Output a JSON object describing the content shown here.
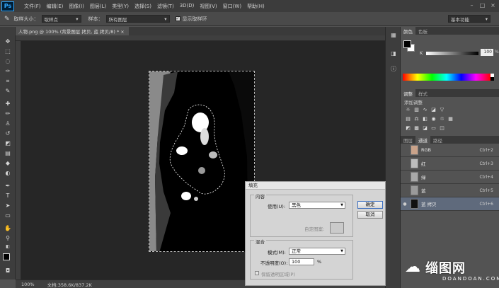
{
  "app": {
    "logo": "Ps",
    "menus": [
      "文件(F)",
      "编辑(E)",
      "图像(I)",
      "图层(L)",
      "类型(Y)",
      "选择(S)",
      "滤镜(T)",
      "3D(D)",
      "视图(V)",
      "窗口(W)",
      "帮助(H)"
    ]
  },
  "options_bar": {
    "sample_size_label": "取样大小：",
    "sample_size_value": "取样点",
    "sample_label": "样本：",
    "sample_value": "所有图层",
    "show_ring_label": "显示取样环",
    "workspace_value": "基本功能"
  },
  "document": {
    "tab_title": "人物.png @ 100% (背景图层 拷贝, 蓝 拷贝/8) * ×"
  },
  "status": {
    "zoom": "100%",
    "doc_info": "文档:358.6K/837.2K"
  },
  "colors": {
    "foreground": "#000000",
    "background": "#ffffff"
  },
  "panels": {
    "color_tabs": [
      "颜色",
      "色板"
    ],
    "color_k_label": "K",
    "color_k_value": "100",
    "color_k_unit": "%",
    "adjust_tabs": [
      "调整",
      "样式"
    ],
    "adjust_title": "添加调整",
    "layer_tabs": [
      "图层",
      "通道",
      "路径"
    ],
    "channels": [
      {
        "name": "RGB",
        "shortcut": "Ctrl+2"
      },
      {
        "name": "红",
        "shortcut": "Ctrl+3"
      },
      {
        "name": "绿",
        "shortcut": "Ctrl+4"
      },
      {
        "name": "蓝",
        "shortcut": "Ctrl+5"
      },
      {
        "name": "蓝 拷贝",
        "shortcut": "Ctrl+6"
      }
    ]
  },
  "fill_dialog": {
    "title": "填充",
    "content_group": "内容",
    "use_label": "使用(U):",
    "use_value": "黑色",
    "custom_pattern_label": "自定图案:",
    "blending_group": "混合",
    "mode_label": "模式(M):",
    "mode_value": "正常",
    "opacity_label": "不透明度(O):",
    "opacity_value": "100",
    "opacity_unit": "%",
    "preserve_label": "保留透明区域(P)",
    "ok_label": "确定",
    "cancel_label": "取消"
  },
  "watermark": {
    "text": "缁图网",
    "sub": "DOANDOAN.COM"
  }
}
